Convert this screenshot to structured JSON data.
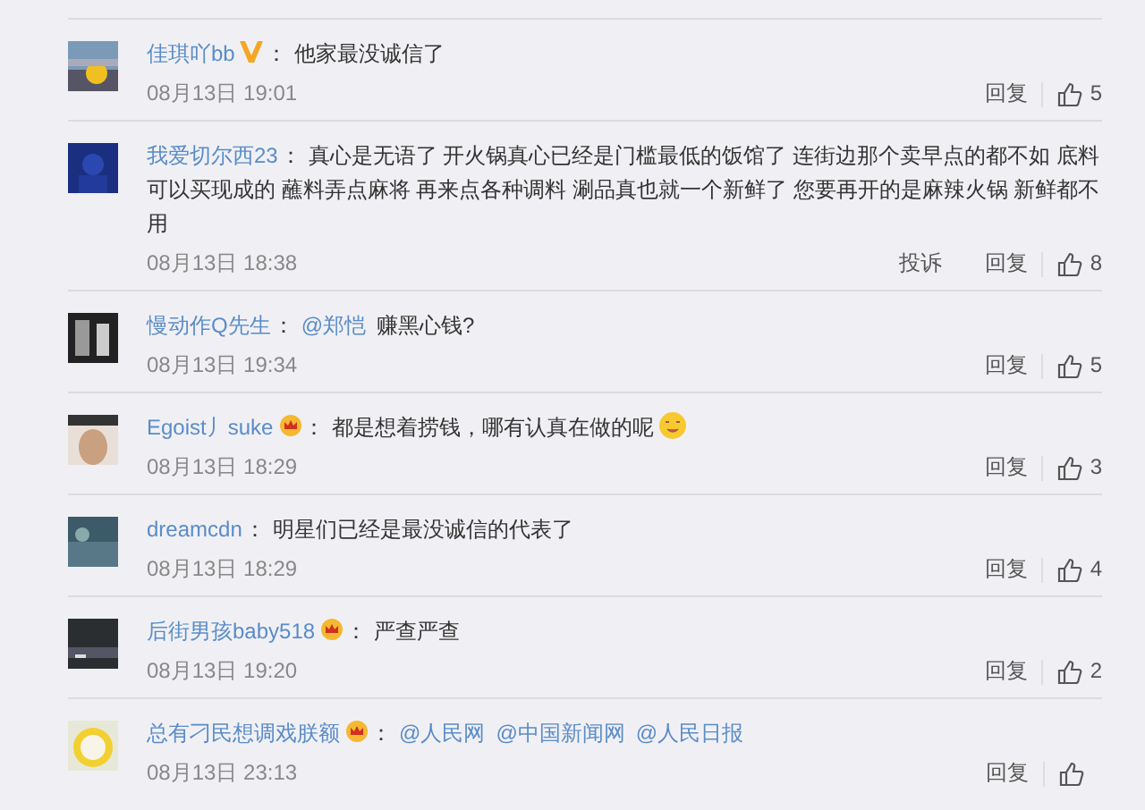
{
  "comments": [
    {
      "user": "佳琪吖bb",
      "verified": true,
      "colon": "：",
      "content": [
        {
          "kind": "text",
          "text": "他家最没诚信了"
        }
      ],
      "emoji": false,
      "time": "08月13日 19:01",
      "reply": "回复",
      "likes": "5"
    },
    {
      "user": "我爱切尔西23",
      "colon": "：",
      "content": [
        {
          "kind": "text",
          "text": "真心是无语了 开火锅真心已经是门槛最低的饭馆了 连街边那个卖早点的都不如 底料可以买现成的 蘸料弄点麻将 再来点各种调料 涮品真也就一个新鲜了 您要再开的是麻辣火锅 新鲜都不用"
        }
      ],
      "emoji": false,
      "time": "08月13日 18:38",
      "report": "投诉",
      "reply": "回复",
      "likes": "8"
    },
    {
      "user": "慢动作Q先生",
      "colon": "：",
      "content": [
        {
          "kind": "mention",
          "text": "@郑恺"
        },
        {
          "kind": "text",
          "text": "赚黑心钱?"
        }
      ],
      "emoji": false,
      "time": "08月13日 19:34",
      "reply": "回复",
      "likes": "5"
    },
    {
      "user": "Egoist丿suke",
      "vip": true,
      "colon": "：",
      "content": [
        {
          "kind": "text",
          "text": "都是想着捞钱，哪有认真在做的呢"
        }
      ],
      "emoji": true,
      "time": "08月13日 18:29",
      "reply": "回复",
      "likes": "3"
    },
    {
      "user": "dreamcdn",
      "colon": "：",
      "content": [
        {
          "kind": "text",
          "text": "明星们已经是最没诚信的代表了"
        }
      ],
      "emoji": false,
      "time": "08月13日 18:29",
      "reply": "回复",
      "likes": "4"
    },
    {
      "user": "后街男孩baby518",
      "vip": true,
      "colon": "：",
      "content": [
        {
          "kind": "text",
          "text": "严查严查"
        }
      ],
      "emoji": false,
      "time": "08月13日 19:20",
      "reply": "回复",
      "likes": "2"
    },
    {
      "user": "总有刁民想调戏朕额",
      "vip": true,
      "colon": "：",
      "content": [
        {
          "kind": "mention",
          "text": "@人民网"
        },
        {
          "kind": "mention",
          "text": "@中国新闻网"
        },
        {
          "kind": "mention",
          "text": "@人民日报"
        }
      ],
      "emoji": false,
      "time": "08月13日 23:13",
      "reply": "回复"
    }
  ]
}
